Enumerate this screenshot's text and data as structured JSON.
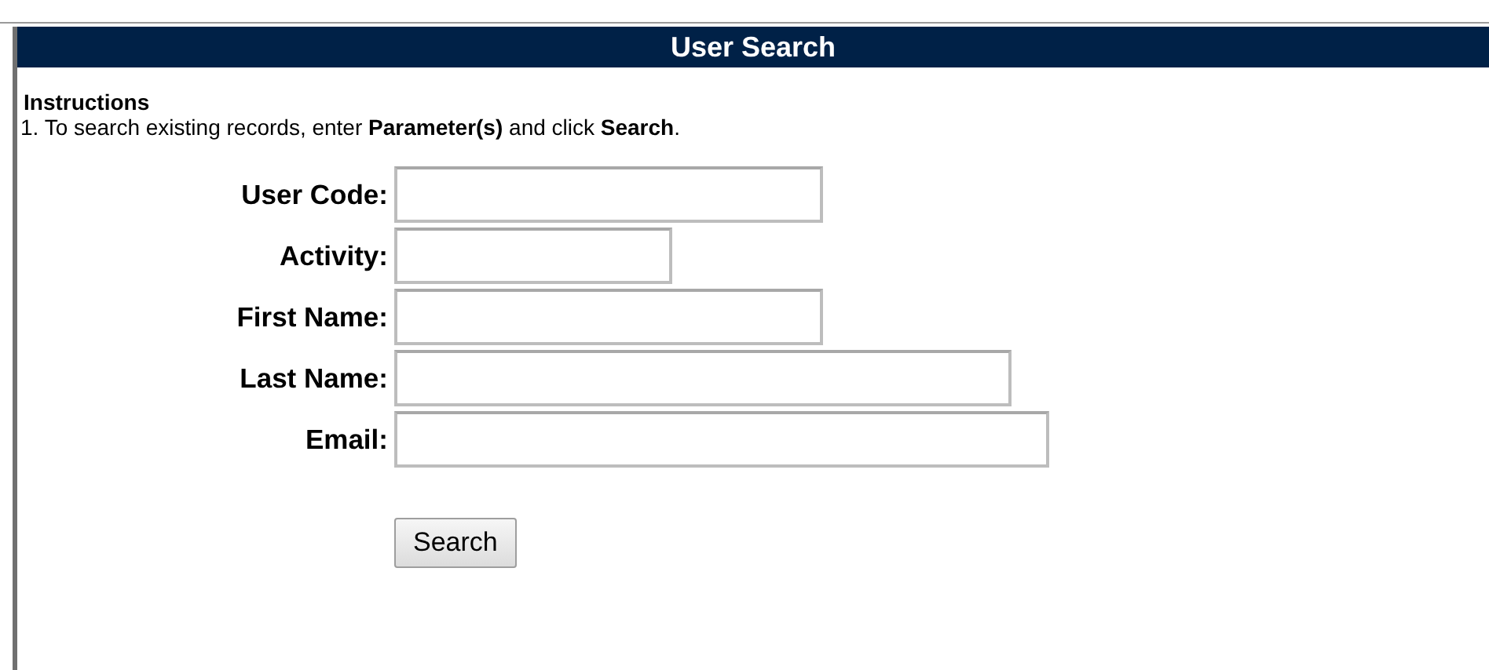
{
  "header": {
    "title": "User Search"
  },
  "instructions": {
    "heading": "Instructions",
    "lines": [
      "1. To search existing records, enter **Parameter(s)** and click **Search**."
    ]
  },
  "fields": [
    {
      "label": "User Code:"
    },
    {
      "label": "Activity:"
    },
    {
      "label": "First Name:"
    },
    {
      "label": "Last Name:"
    },
    {
      "label": "Email:"
    }
  ],
  "buttons": [
    {
      "label": "Search"
    }
  ]
}
